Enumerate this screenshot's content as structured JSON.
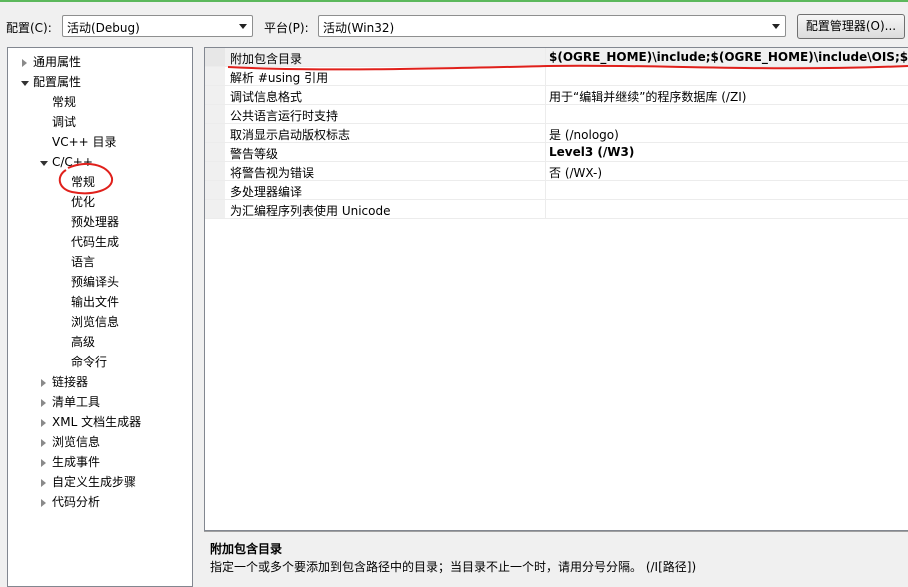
{
  "toolbar": {
    "config_label": "配置(C):",
    "config_value": "活动(Debug)",
    "platform_label": "平台(P):",
    "platform_value": "活动(Win32)",
    "config_manager_button": "配置管理器(O)..."
  },
  "tree": {
    "items": [
      {
        "label": "通用属性",
        "expander": "closed"
      },
      {
        "label": "配置属性",
        "expander": "open"
      },
      {
        "label": "常规"
      },
      {
        "label": "调试"
      },
      {
        "label": "VC++ 目录"
      },
      {
        "label": "C/C++",
        "expander": "open"
      },
      {
        "label": "常规",
        "selected": true
      },
      {
        "label": "优化"
      },
      {
        "label": "预处理器"
      },
      {
        "label": "代码生成"
      },
      {
        "label": "语言"
      },
      {
        "label": "预编译头"
      },
      {
        "label": "输出文件"
      },
      {
        "label": "浏览信息"
      },
      {
        "label": "高级"
      },
      {
        "label": "命令行"
      },
      {
        "label": "链接器",
        "expander": "closed"
      },
      {
        "label": "清单工具",
        "expander": "closed"
      },
      {
        "label": "XML 文档生成器",
        "expander": "closed"
      },
      {
        "label": "浏览信息",
        "expander": "closed"
      },
      {
        "label": "生成事件",
        "expander": "closed"
      },
      {
        "label": "自定义生成步骤",
        "expander": "closed"
      },
      {
        "label": "代码分析",
        "expander": "closed"
      }
    ]
  },
  "properties": {
    "rows": [
      {
        "name": "附加包含目录",
        "value": "$(OGRE_HOME)\\include;$(OGRE_HOME)\\include\\OIS;$(OGRE_HOME)",
        "bold": true,
        "selected": true
      },
      {
        "name": "解析 #using 引用",
        "value": ""
      },
      {
        "name": "调试信息格式",
        "value": "用于“编辑并继续”的程序数据库 (/ZI)"
      },
      {
        "name": "公共语言运行时支持",
        "value": ""
      },
      {
        "name": "取消显示启动版权标志",
        "value": "是 (/nologo)"
      },
      {
        "name": "警告等级",
        "value": "Level3 (/W3)",
        "bold": true
      },
      {
        "name": "将警告视为错误",
        "value": "否 (/WX-)"
      },
      {
        "name": "多处理器编译",
        "value": ""
      },
      {
        "name": "为汇编程序列表使用 Unicode",
        "value": ""
      }
    ]
  },
  "description": {
    "title": "附加包含目录",
    "text": "指定一个或多个要添加到包含路径中的目录；当目录不止一个时，请用分号分隔。     (/I[路径])"
  },
  "colors": {
    "annotation": "#e0201b",
    "accent_line": "#5cb85c"
  }
}
